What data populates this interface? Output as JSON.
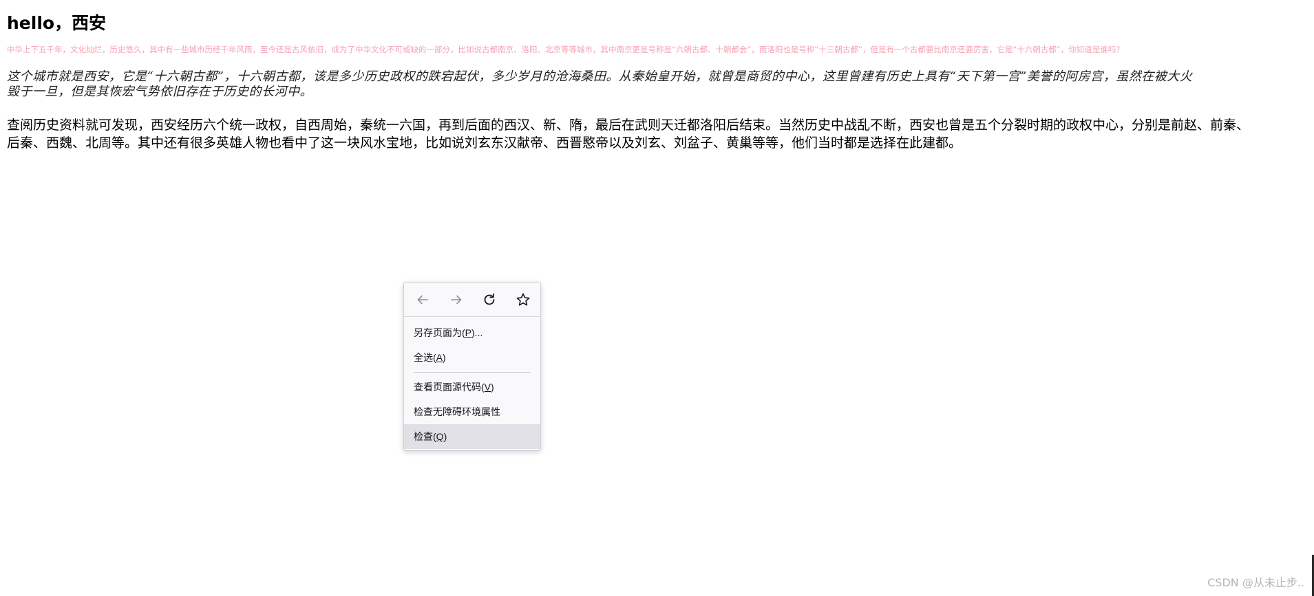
{
  "heading": "hello，西安",
  "intro_pink": "中华上下五千年，文化灿烂，历史悠久，其中有一些城市历经千年风雨，至今还是古风依旧，成为了中华文化不可或缺的一部分，比如说古都南京、洛阳、北京等等城市，其中南京更是号称是“六朝古都、十朝都会”，而洛阳也是号称“十三朝古都”，但是有一个古都要比南京还要厉害，它是“十六朝古都”，你知道是谁吗？",
  "italic_paragraph": {
    "line1": "这个城市就是西安，它是“十六朝古都”，十六朝古都，该是多少历史政权的跌宕起伏，多少岁月的沧海桑田。从秦始皇开始，就曾是商贸的中心，这里曾建有历史上具有“天下第一宫”美誉的阿房宫，虽然在被大火",
    "line2": "毁于一旦，但是其恢宏气势依旧存在于历史的长河中。"
  },
  "plain_paragraph": {
    "line1": "查阅历史资料就可发现，西安经历六个统一政权，自西周始，秦统一六国，再到后面的西汉、新、隋，最后在武则天迁都洛阳后结束。当然历史中战乱不断，西安也曾是五个分裂时期的政权中心，分别是前赵、前秦、",
    "line2": "后秦、西魏、北周等。其中还有很多英雄人物也看中了这一块风水宝地，比如说刘玄东汉献帝、西晋愍帝以及刘玄、刘盆子、黄巢等等，他们当时都是选择在此建都。"
  },
  "context_menu": {
    "nav": {
      "back_icon": "arrow-left-icon",
      "forward_icon": "arrow-right-icon",
      "reload_icon": "reload-icon",
      "bookmark_icon": "star-icon"
    },
    "items": [
      {
        "label": "另存页面为(",
        "accesskey": "P",
        "suffix": ")..."
      },
      {
        "label": "全选(",
        "accesskey": "A",
        "suffix": ")"
      },
      {
        "label": "查看页面源代码(",
        "accesskey": "V",
        "suffix": ")"
      },
      {
        "label": "检查无障碍环境属性"
      },
      {
        "label": "检查(",
        "accesskey": "Q",
        "suffix": ")"
      }
    ]
  },
  "watermark": "CSDN @从未止步..",
  "colors": {
    "pink_text": "#f5a3b4",
    "menu_bg": "#f9f9fb",
    "menu_highlight": "#e0e0e6",
    "icon_gray": "#8f8f9d",
    "icon_dark": "#15141a"
  }
}
